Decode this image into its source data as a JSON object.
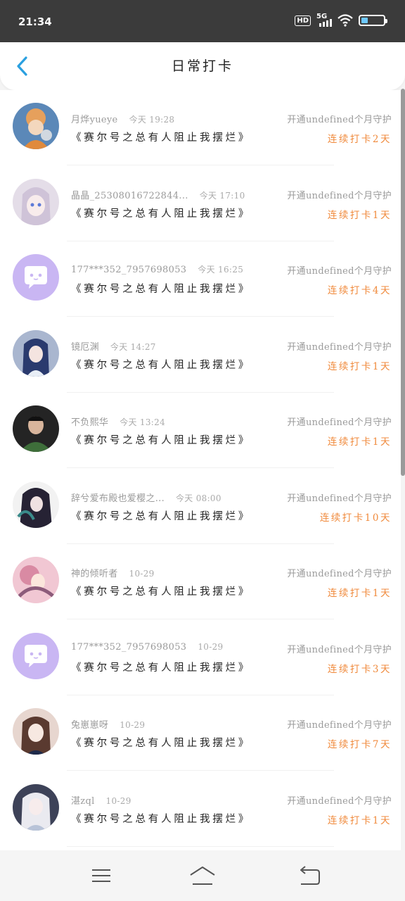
{
  "status": {
    "time": "21:34",
    "hd": "HD",
    "network": "5G",
    "battery_level": 0.3
  },
  "header": {
    "title": "日常打卡"
  },
  "items": [
    {
      "name": "月烨yueye",
      "time": "今天 19:28",
      "group": "《赛尔号之总有人阻止我摆烂》",
      "member": "开通undefined个月守护",
      "streak": "连续打卡2天",
      "avatar": "orange"
    },
    {
      "name": "晶晶_25308016722844...",
      "time": "今天 17:10",
      "group": "《赛尔号之总有人阻止我摆烂》",
      "member": "开通undefined个月守护",
      "streak": "连续打卡1天",
      "avatar": "silver"
    },
    {
      "name": "177***352_7957698053",
      "time": "今天 16:25",
      "group": "《赛尔号之总有人阻止我摆烂》",
      "member": "开通undefined个月守护",
      "streak": "连续打卡4天",
      "avatar": "default"
    },
    {
      "name": "镜厄渊",
      "time": "今天 14:27",
      "group": "《赛尔号之总有人阻止我摆烂》",
      "member": "开通undefined个月守护",
      "streak": "连续打卡1天",
      "avatar": "blue"
    },
    {
      "name": "不负熙华",
      "time": "今天 13:24",
      "group": "《赛尔号之总有人阻止我摆烂》",
      "member": "开通undefined个月守护",
      "streak": "连续打卡1天",
      "avatar": "green"
    },
    {
      "name": "辞兮爱布殿也爱樱之...",
      "time": "今天 08:00",
      "group": "《赛尔号之总有人阻止我摆烂》",
      "member": "开通undefined个月守护",
      "streak": "连续打卡10天",
      "avatar": "dark"
    },
    {
      "name": "神的倾听者",
      "time": "10-29",
      "group": "《赛尔号之总有人阻止我摆烂》",
      "member": "开通undefined个月守护",
      "streak": "连续打卡1天",
      "avatar": "pink"
    },
    {
      "name": "177***352_7957698053",
      "time": "10-29",
      "group": "《赛尔号之总有人阻止我摆烂》",
      "member": "开通undefined个月守护",
      "streak": "连续打卡3天",
      "avatar": "default"
    },
    {
      "name": "兔崽崽呀",
      "time": "10-29",
      "group": "《赛尔号之总有人阻止我摆烂》",
      "member": "开通undefined个月守护",
      "streak": "连续打卡7天",
      "avatar": "brown"
    },
    {
      "name": "湛zql",
      "time": "10-29",
      "group": "《赛尔号之总有人阻止我摆烂》",
      "member": "开通undefined个月守护",
      "streak": "连续打卡1天",
      "avatar": "white"
    }
  ],
  "colors": {
    "accent": "#2aa0e0",
    "streak": "#f08a3c",
    "default_avatar": "#c9b6f3"
  },
  "nav": {
    "menu": "menu-icon",
    "home": "home-icon",
    "back": "back-icon"
  }
}
